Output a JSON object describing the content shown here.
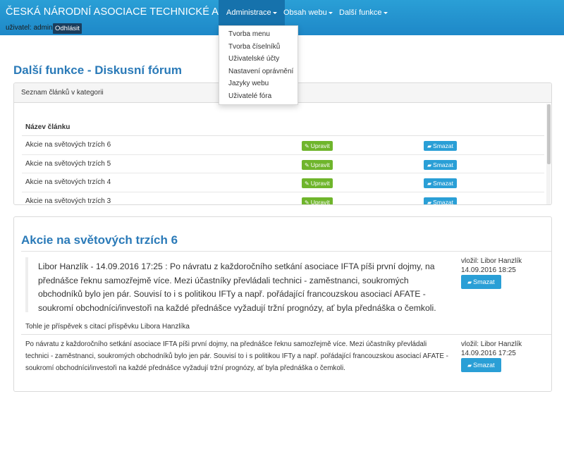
{
  "header": {
    "brand": "ČESKÁ NÁRODNÍ ASOCIACE TECHNICKÉ ANALÝZY",
    "user_label": "uživatel: admin",
    "logout": "Odhlásit",
    "nav": [
      {
        "label": "Administrace"
      },
      {
        "label": "Obsah webu"
      },
      {
        "label": "Další funkce"
      }
    ]
  },
  "dropdown": {
    "items": [
      "Tvorba menu",
      "Tvorba číselníků",
      "Uživatelské účty",
      "Nastavení oprávnění",
      "Jazyky webu",
      "Uživatelé fóra"
    ]
  },
  "page": {
    "title": "Další funkce - Diskusní fórum"
  },
  "articles_panel": {
    "heading": "Seznam článků v kategorii",
    "column": "Název článku",
    "edit_label": "Upravit",
    "delete_label": "Smazat",
    "rows": [
      "Akcie na světových trzích 6",
      "Akcie na světových trzích 5",
      "Akcie na světových trzích 4",
      "Akcie na světových trzích 3"
    ]
  },
  "thread": {
    "title": "Akcie na světových trzích 6",
    "posts": [
      {
        "text": "Libor Hanzlík - 14.09.2016 17:25 : Po návratu z každoročního setkání asociace IFTA píši první dojmy, na přednášce řeknu samozřejmě více. Mezi účastníky převládali technici - zaměstnanci, soukromých obchodníků bylo jen pár. Souvisí to i s politikou IFTy a např. pořádající francouzskou asociací AFATE - soukromí obchodníci/investoři na každé přednášce vyžadují tržní prognózy, ať byla přednáška o čemkoli.",
        "subtitle": "Tohle je příspěvek s citací příspěvku Libora Hanzlíka",
        "author": "vložil: Libor Hanzlík",
        "date": "14.09.2016 18:25",
        "delete_label": "Smazat"
      },
      {
        "text": "Po návratu z každoročního setkání asociace IFTA píši první dojmy, na přednášce řeknu samozřejmě více. Mezi účastníky převládali technici - zaměstnanci, soukromých obchodníků bylo jen pár. Souvisí to i s politikou IFTy a např. pořádající francouzskou asociací AFATE - soukromí obchodníci/investoři na každé přednášce vyžadují tržní prognózy, ať byla přednáška o čemkoli.",
        "author": "vložil: Libor Hanzlík",
        "date": "14.09.2016 17:25",
        "delete_label": "Smazat"
      }
    ]
  },
  "colors": {
    "header": "#2a9fd6",
    "active_nav": "#1672ac",
    "title": "#2a7ab8",
    "edit_button": "#6fb52c",
    "delete_button": "#2a9fd6"
  },
  "icons": {
    "edit": "pencil-icon",
    "delete": "eraser-icon"
  }
}
